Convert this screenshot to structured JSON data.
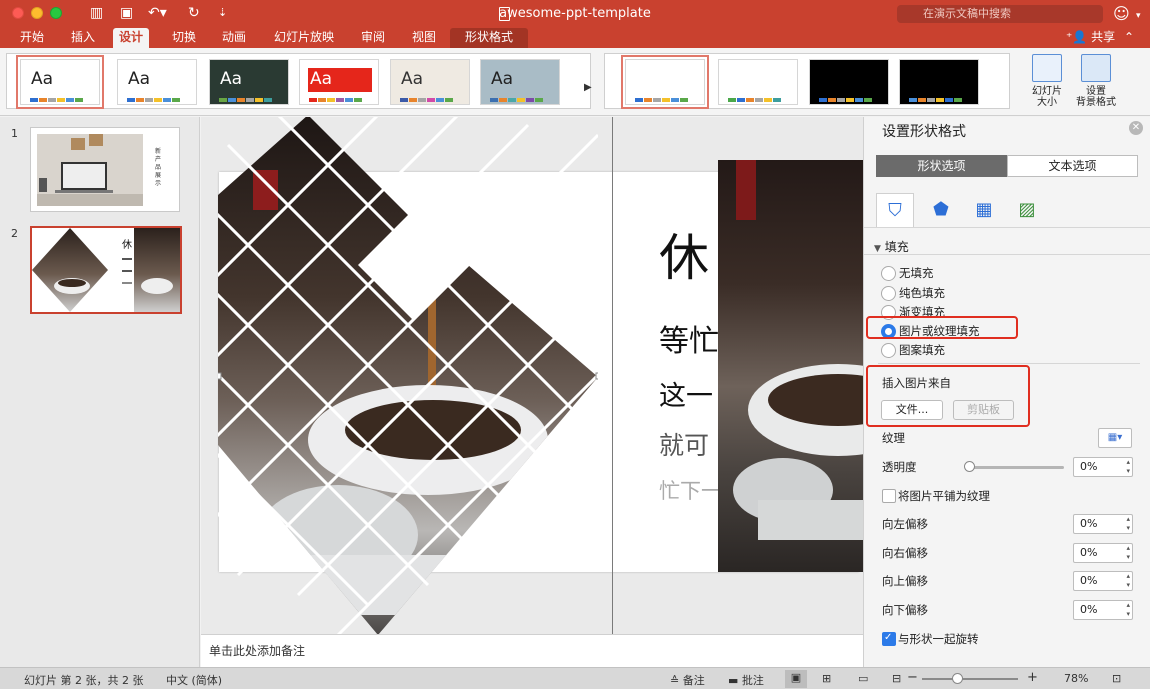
{
  "window": {
    "title": "awesome-ppt-template",
    "search_placeholder": "在演示文稿中搜索"
  },
  "ribbon_tabs": [
    "开始",
    "插入",
    "设计",
    "切换",
    "动画",
    "幻灯片放映",
    "审阅",
    "视图",
    "形状格式"
  ],
  "active_tab": "设计",
  "share_label": "共享",
  "themes": [
    {
      "label": "Aa",
      "bg": "#ffffff",
      "fg": "#222222",
      "bars": [
        "#2e6fd0",
        "#e8842b",
        "#a5a5a5",
        "#f4c12a",
        "#4a8fd9",
        "#5aa84a"
      ]
    },
    {
      "label": "Aa",
      "bg": "#ffffff",
      "fg": "#222222",
      "bars": [
        "#2e6fd0",
        "#e8842b",
        "#a5a5a5",
        "#f4c12a",
        "#4a8fd9",
        "#5aa84a"
      ]
    },
    {
      "label": "Aa",
      "bg": "#2a3a33",
      "fg": "#ffffff",
      "bars": [
        "#68a644",
        "#4a8fd9",
        "#e8842b",
        "#a5a5a5",
        "#f4c12a",
        "#3d9e9e"
      ]
    },
    {
      "label": "Aa",
      "bg": "#ffffff",
      "fg": "#ffffff",
      "bars": [
        "#e5261b",
        "#e8842b",
        "#f4c12a",
        "#9c5aa8",
        "#4a8fd9",
        "#5aa84a"
      ]
    },
    {
      "label": "Aa",
      "bg": "#efeae2",
      "fg": "#333333",
      "bars": [
        "#3b5aa8",
        "#e8842b",
        "#a5a5a5",
        "#d24aa8",
        "#4a8fd9",
        "#5aa84a"
      ]
    },
    {
      "label": "Aa",
      "bg": "#a9bcc6",
      "fg": "#222222",
      "bars": [
        "#3b6fb0",
        "#e8842b",
        "#4aa8a8",
        "#f4c12a",
        "#7d4aa8",
        "#5aa84a"
      ]
    }
  ],
  "variants": [
    {
      "bg": "#ffffff",
      "bars": [
        "#2e6fd0",
        "#e8842b",
        "#a5a5a5",
        "#f4c12a",
        "#4a8fd9",
        "#5aa84a"
      ]
    },
    {
      "bg": "#ffffff",
      "bars": [
        "#4aa84a",
        "#2e6fd0",
        "#e8842b",
        "#a5a5a5",
        "#f4c12a",
        "#3d9e9e"
      ]
    },
    {
      "bg": "#000000",
      "bars": [
        "#2e6fd0",
        "#e8842b",
        "#a5a5a5",
        "#f4c12a",
        "#4a8fd9",
        "#5aa84a"
      ]
    },
    {
      "bg": "#000000",
      "bars": [
        "#4a8fd9",
        "#e8842b",
        "#a5a5a5",
        "#f4c12a",
        "#2e6fd0",
        "#5aa84a"
      ]
    }
  ],
  "ribbon_buttons": {
    "slide_size": "幻灯片\n大小",
    "format_background": "设置\n背景格式"
  },
  "thumbnails": [
    {
      "number": "1",
      "caption": "新产品展示"
    },
    {
      "number": "2",
      "caption": "休"
    }
  ],
  "slide": {
    "lines": [
      "休",
      "等忙",
      "这一",
      "就可",
      "忙下一"
    ]
  },
  "notes_placeholder": "单击此处添加备注",
  "format_pane": {
    "title": "设置形状格式",
    "tab_shape": "形状选项",
    "tab_text": "文本选项",
    "fill_section": "填充",
    "fill_options": [
      {
        "label": "无填充",
        "checked": false
      },
      {
        "label": "纯色填充",
        "checked": false
      },
      {
        "label": "渐变填充",
        "checked": false
      },
      {
        "label": "图片或纹理填充",
        "checked": true
      },
      {
        "label": "图案填充",
        "checked": false
      }
    ],
    "insert_from": "插入图片来自",
    "file_button": "文件...",
    "clipboard_button": "剪贴板",
    "texture_label": "纹理",
    "transparency_label": "透明度",
    "transparency_value": "0%",
    "tile_label": "将图片平铺为纹理",
    "tile_checked": false,
    "offsets": [
      {
        "label": "向左偏移",
        "value": "0%"
      },
      {
        "label": "向右偏移",
        "value": "0%"
      },
      {
        "label": "向上偏移",
        "value": "0%"
      },
      {
        "label": "向下偏移",
        "value": "0%"
      }
    ],
    "rotate_label": "与形状一起旋转",
    "rotate_checked": true
  },
  "status_bar": {
    "slide_info": "幻灯片 第 2 张，共 2 张",
    "language": "中文 (简体)",
    "notes": "备注",
    "comments": "批注",
    "zoom": "78%"
  }
}
